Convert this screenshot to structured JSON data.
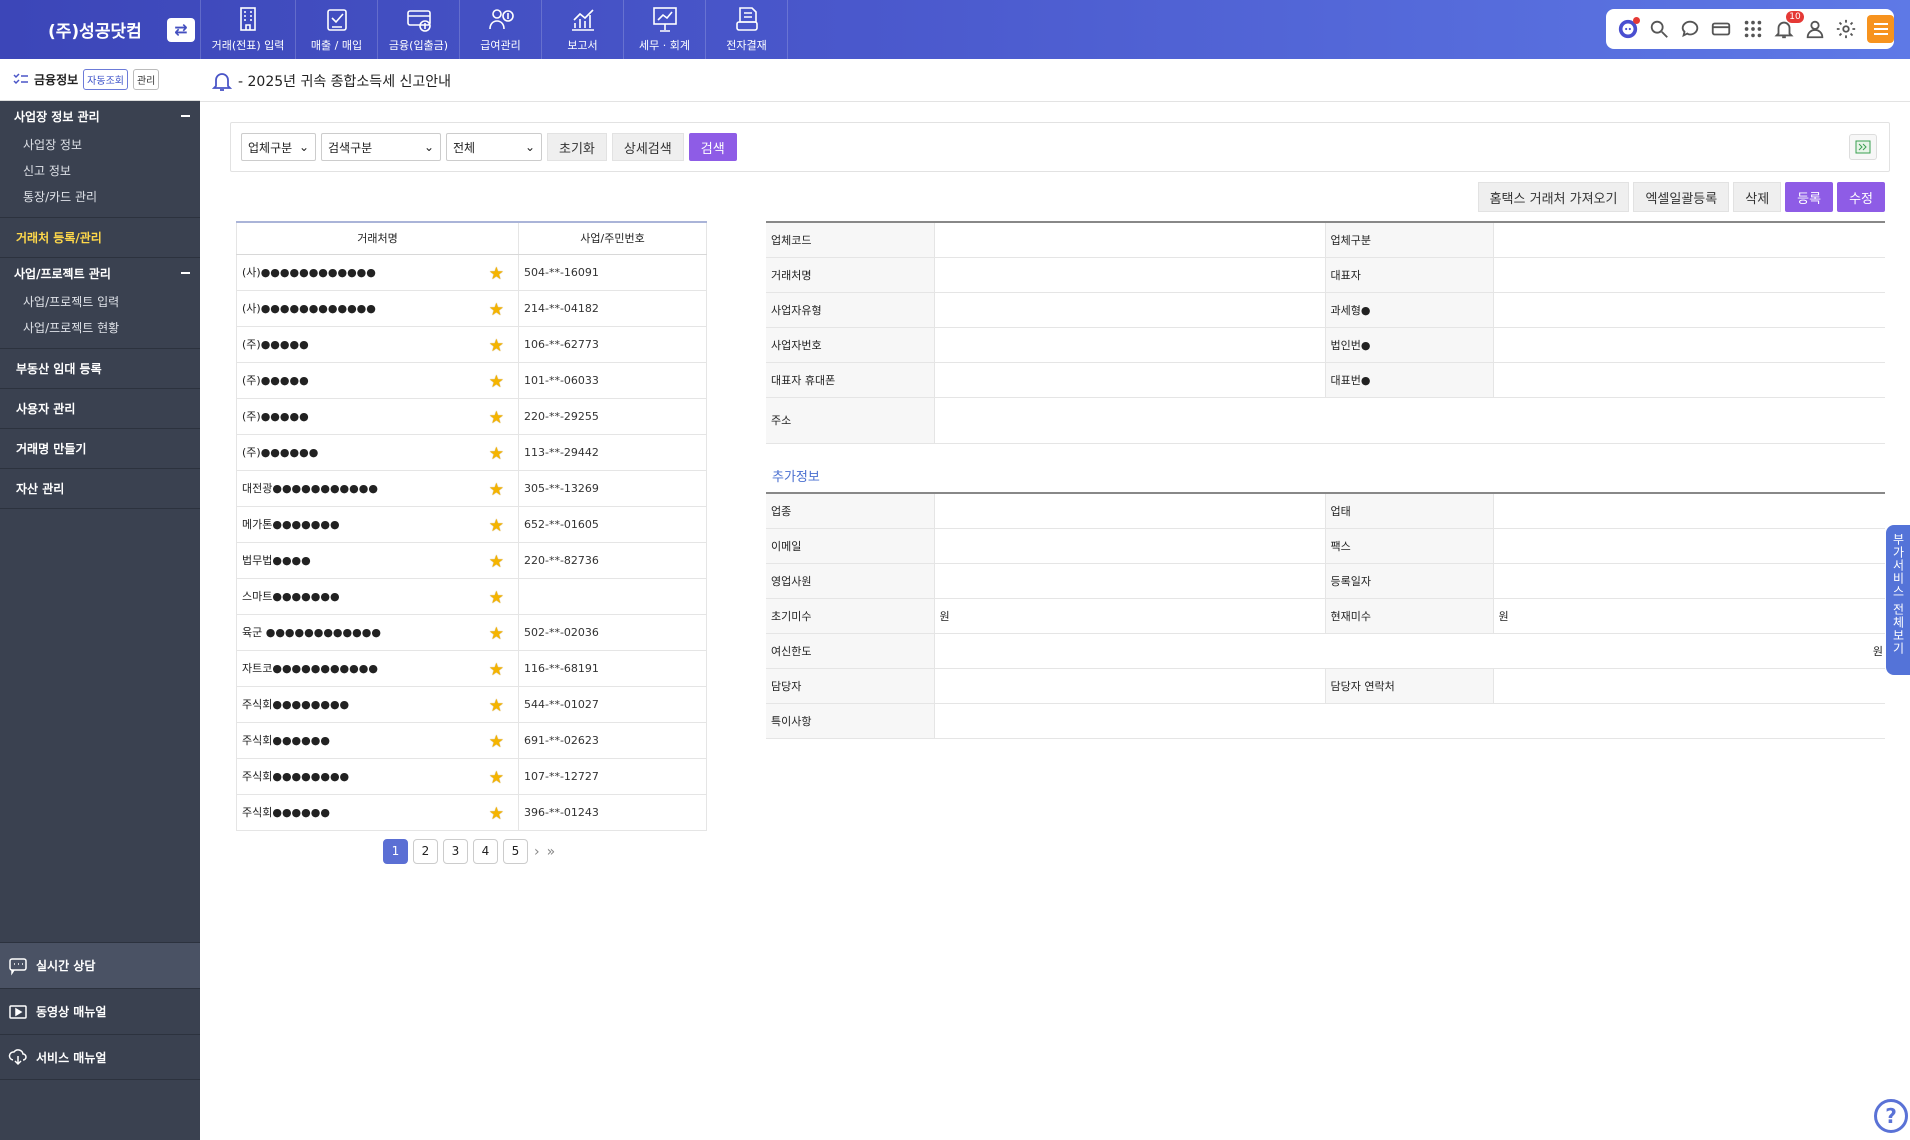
{
  "header": {
    "brand": "(주)성공닷컴",
    "nav": [
      {
        "label": "거래(전표) 입력",
        "icon": "building-icon"
      },
      {
        "label": "매출 / 매입",
        "icon": "sales-purchase-icon"
      },
      {
        "label": "금융(입출금)",
        "icon": "finance-icon"
      },
      {
        "label": "급여관리",
        "icon": "payroll-icon"
      },
      {
        "label": "보고서",
        "icon": "report-chart-icon"
      },
      {
        "label": "세무 · 회계",
        "icon": "tax-presentation-icon"
      },
      {
        "label": "전자결재",
        "icon": "e-approval-icon"
      }
    ],
    "notification_count": "10"
  },
  "sidebar": {
    "header_title": "금융정보",
    "chip_auto": "자동조회",
    "chip_manage": "관리",
    "groups": [
      {
        "title": "사업장 정보 관리",
        "items": [
          "사업장 정보",
          "신고 정보",
          "통장/카드 관리"
        ]
      },
      {
        "title": "사업/프로젝트 관리",
        "items": [
          "사업/프로젝트 입력",
          "사업/프로젝트 현황"
        ]
      }
    ],
    "active_item": "거래처 등록/관리",
    "items": [
      "부동산 임대 등록",
      "사용자 관리",
      "거래명 만들기",
      "자산 관리"
    ],
    "bottom": [
      "실시간 상담",
      "동영상 매뉴얼",
      "서비스 매뉴얼"
    ]
  },
  "notice": "- 2025년 귀속 종합소득세 신고안내",
  "search": {
    "type_select": "업체구분",
    "search_select": "검색구분",
    "scope_select": "전체",
    "reset_label": "초기화",
    "detail_label": "상세검색",
    "search_label": "검색"
  },
  "actions": {
    "hometax": "홈택스 거래처 가져오기",
    "excel": "엑셀일괄등록",
    "delete": "삭제",
    "register": "등록",
    "edit": "수정"
  },
  "list": {
    "headers": [
      "거래처명",
      "사업/주민번호"
    ],
    "rows": [
      {
        "name": "(사)●●●●●●●●●●●●",
        "biz": "504-**-16091"
      },
      {
        "name": "(사)●●●●●●●●●●●●",
        "biz": "214-**-04182"
      },
      {
        "name": "(주)●●●●●",
        "biz": "106-**-62773"
      },
      {
        "name": "(주)●●●●●",
        "biz": "101-**-06033"
      },
      {
        "name": "(주)●●●●●",
        "biz": "220-**-29255"
      },
      {
        "name": "(주)●●●●●●",
        "biz": "113-**-29442"
      },
      {
        "name": "대전광●●●●●●●●●●●",
        "biz": "305-**-13269"
      },
      {
        "name": "메가톤●●●●●●●",
        "biz": "652-**-01605"
      },
      {
        "name": "법무법●●●●",
        "biz": "220-**-82736"
      },
      {
        "name": "스마트●●●●●●●",
        "biz": ""
      },
      {
        "name": "육군 ●●●●●●●●●●●●",
        "biz": "502-**-02036"
      },
      {
        "name": "자트코●●●●●●●●●●●",
        "biz": "116-**-68191"
      },
      {
        "name": "주식회●●●●●●●●",
        "biz": "544-**-01027"
      },
      {
        "name": "주식회●●●●●●",
        "biz": "691-**-02623"
      },
      {
        "name": "주식회●●●●●●●●",
        "biz": "107-**-12727"
      },
      {
        "name": "주식회●●●●●●",
        "biz": "396-**-01243"
      }
    ]
  },
  "pagination": [
    "1",
    "2",
    "3",
    "4",
    "5"
  ],
  "form": {
    "code": "업체코드",
    "company_type": "업체구분",
    "name": "거래처명",
    "ceo": "대표자",
    "biz_type": "사업자유형",
    "tax_type": "과세형●",
    "biz_no": "사업자번호",
    "corp_no": "법인번●",
    "ceo_phone": "대표자 휴대폰",
    "main_no": "대표번●",
    "address": "주소",
    "extra_title": "추가정보",
    "industry": "업종",
    "business": "업태",
    "email": "이메일",
    "fax": "팩스",
    "sales_rep": "영업사원",
    "reg_date": "등록일자",
    "init_unpaid": "초기미수",
    "init_unpaid_unit": "원",
    "curr_unpaid": "현재미수",
    "curr_unpaid_unit": "원",
    "credit_limit": "여신한도",
    "credit_unit": "원",
    "manager": "담당자",
    "manager_contact": "담당자 연락처",
    "remarks": "특이사항"
  },
  "side_tab": "부가서비스 전체보기",
  "help": "?"
}
